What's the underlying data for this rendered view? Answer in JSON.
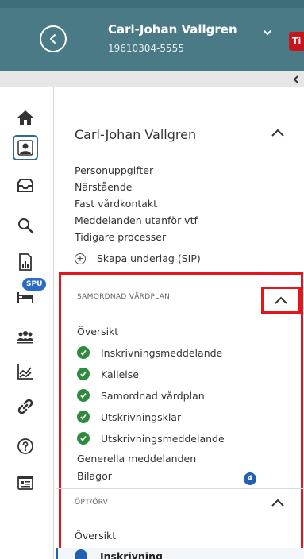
{
  "header": {
    "patient_name": "Carl-Johan Vallgren",
    "patient_id": "19610304-5555",
    "badge_text": "Ti",
    "colors": {
      "header_bg": "#4a7a86",
      "badge": "#c4161c"
    }
  },
  "rail": {
    "icons": [
      "home-icon",
      "patient-icon",
      "inbox-icon",
      "search-icon",
      "document-chart-icon",
      "bed-icon",
      "group-icon",
      "trend-chart-icon",
      "link-icon",
      "help-icon",
      "card-icon"
    ],
    "spu_badge": "SPU"
  },
  "patient_section": {
    "title": "Carl-Johan Vallgren",
    "items": [
      "Personuppgifter",
      "Närstående",
      "Fast vårdkontakt",
      "Meddelanden utanför vtf",
      "Tidigare processer"
    ],
    "sip_label": "Skapa underlag (SIP)"
  },
  "samordnad": {
    "heading": "SAMORDNAD VÅRDPLAN",
    "overview": "Översikt",
    "checked_items": [
      "Inskrivningsmeddelande",
      "Kallelse",
      "Samordnad vårdplan",
      "Utskrivningsklar",
      "Utskrivningsmeddelande"
    ],
    "general_messages": "Generella meddelanden",
    "attachments": "Bilagor",
    "attachments_count": "4"
  },
  "opt": {
    "heading": "ÖPT/ÖRV",
    "overview": "Översikt",
    "active_item": "Inskrivning"
  },
  "colors": {
    "highlight": "#e3151a",
    "check": "#2e8b3e",
    "accent_blue": "#2360b0"
  }
}
